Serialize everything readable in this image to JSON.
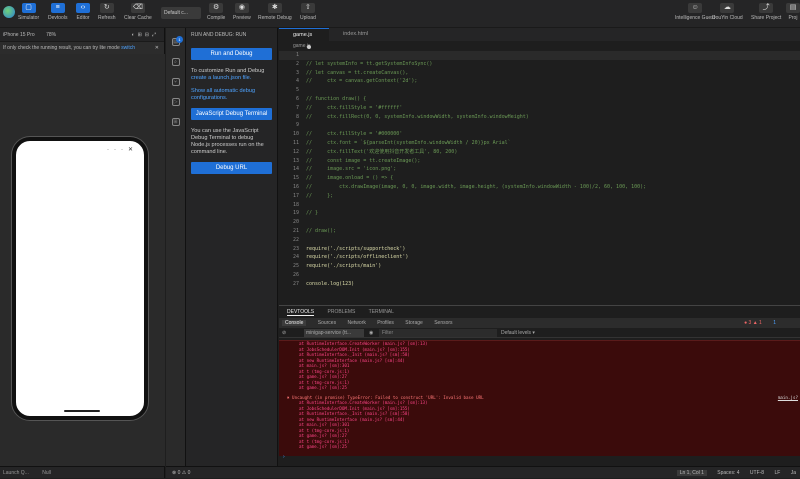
{
  "toolbar": {
    "simulator": "Simulator",
    "devtools": "Devtools",
    "editor": "Editor",
    "refresh": "Refresh",
    "clear_cache": "Clear Cache",
    "mode_select": "Default c...",
    "compile": "Compile",
    "preview": "Preview",
    "remote_debug": "Remote Debug",
    "upload": "Upload",
    "intelligence_guest": "Intelligence Guest",
    "douyin_cloud": "DouYin Cloud",
    "share_project": "Share Project",
    "more": "Proj"
  },
  "simulator": {
    "device": "iPhone 15 Pro",
    "zoom": "78%",
    "notice": "If only check the running result, you can try lite mode",
    "notice_link": "switch",
    "footer_left": "Launch Q...",
    "footer_right": "Null"
  },
  "run_panel": {
    "title": "RUN AND DEBUG: RUN",
    "run_button": "Run and Debug",
    "customize_text": "To customize Run and Debug",
    "customize_link": "create a launch.json file.",
    "show_link": "Show all automatic debug configurations.",
    "js_button": "JavaScript Debug Terminal",
    "js_text": "You can use the JavaScript Debug Terminal to debug Node.js processes run on the command line.",
    "debug_url_button": "Debug URL"
  },
  "editor": {
    "tabs": [
      {
        "label": "game.js"
      },
      {
        "label": "index.html"
      }
    ],
    "breadcrumb": "game.js",
    "lines": [
      "",
      "// let systemInfo = tt.getSystemInfoSync()",
      "// let canvas = tt.createCanvas(),",
      "//     ctx = canvas.getContext('2d');",
      "",
      "// function draw() {",
      "//     ctx.fillStyle = '#ffffff'",
      "//     ctx.fillRect(0, 0, systemInfo.windowWidth, systemInfo.windowHeight)",
      "",
      "//     ctx.fillStyle = '#000000'",
      "//     ctx.font = `${parseInt(systemInfo.windowWidth / 20)}px Arial`",
      "//     ctx.fillText('欢迎使用抖音开发者工具', 80, 200)",
      "//     const image = tt.createImage();",
      "//     image.src = 'icon.png';",
      "//     image.onload = () => {",
      "//         ctx.drawImage(image, 0, 0, image.width, image.height, (systemInfo.windowWidth - 100)/2, 60, 100, 100);",
      "//     };",
      "",
      "// }",
      "",
      "// draw();",
      "",
      "require('./scripts/supportcheck')",
      "require('./scripts/offlineclient')",
      "require('./scripts/main')",
      "",
      "console.log(123)"
    ]
  },
  "panel": {
    "tabs": [
      "DEVTOOLS",
      "PROBLEMS",
      "TERMINAL"
    ],
    "dev_tabs": [
      "Console",
      "Sources",
      "Network",
      "Profiles",
      "Storage",
      "Sensors"
    ],
    "counts": "● 3 ▲ 1",
    "info_count": "1",
    "context": "minigap-service (tt...",
    "filter_placeholder": "Filter",
    "levels": "Default levels ▾",
    "error_lines": [
      "at RuntimeInterface.CreateWorker (main.js? [sm]:13)",
      "at JobsSchedulerDOM.Init (main.js? [sm]:155)",
      "at RuntimeInterface._Init (main.js? [sm]:58)",
      "at new RuntimeInterface (main.js? [sm]:44)",
      "at main.js? [sm]:301",
      "at t (tmg-core.js:1)",
      "at game.js? [sm]:27",
      "at t (tmg-core.js:1)",
      "at game.js? [sm]:25"
    ],
    "error_head": "✖ Uncaught (in promise) TypeError: Failed to construct 'URL': Invalid base URL",
    "error_src": "main.js?",
    "error_lines2": [
      "at RuntimeInterface.CreateWorker (main.js? [sm]:13)",
      "at JobsSchedulerDOM.Init (main.js? [sm]:155)",
      "at RuntimeInterface._Init (main.js? [sm]:58)",
      "at new RuntimeInterface (main.js? [sm]:44)",
      "at main.js? [sm]:301",
      "at t (tmg-core.js:1)",
      "at game.js? [sm]:27",
      "at t (tmg-core.js:1)",
      "at game.js? [sm]:25"
    ]
  },
  "status": {
    "left": "⊗ 0 ⚠ 0",
    "position": "Ln 1, Col 1",
    "spaces": "Spaces: 4",
    "encoding": "UTF-8",
    "eol": "LF",
    "lang": "Ja"
  }
}
